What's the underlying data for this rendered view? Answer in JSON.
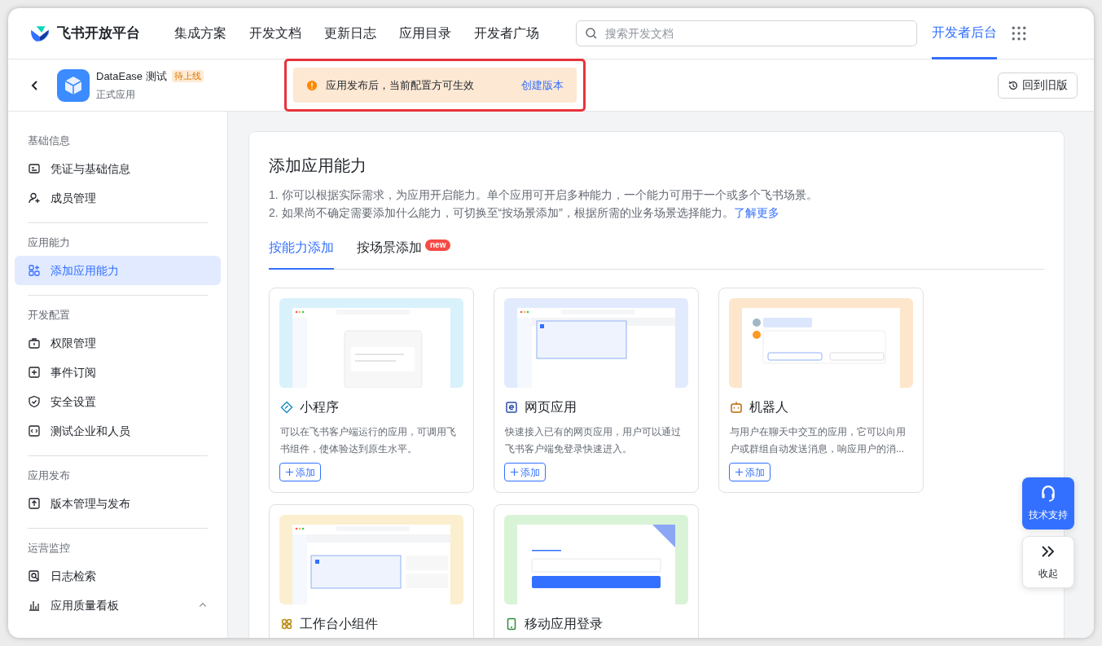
{
  "nav": {
    "brand": "飞书开放平台",
    "links": [
      {
        "label": "集成方案",
        "selected": false
      },
      {
        "label": "开发文档",
        "selected": false
      },
      {
        "label": "更新日志",
        "selected": false
      },
      {
        "label": "应用目录",
        "selected": false
      },
      {
        "label": "开发者广场",
        "selected": false
      }
    ],
    "search": {
      "placeholder": "搜索开发文档"
    },
    "console": {
      "label": "开发者后台",
      "selected": true
    }
  },
  "app": {
    "name": "DataEase 测试",
    "badge": "待上线",
    "type": "正式应用"
  },
  "alert": {
    "message": "应用发布后，当前配置方可生效",
    "link": "创建版本",
    "highlighted": true
  },
  "old_version_button": "回到旧版",
  "sidebar": [
    {
      "title": "基础信息",
      "items": [
        {
          "label": "凭证与基础信息",
          "selected": false
        },
        {
          "label": "成员管理",
          "selected": false
        }
      ]
    },
    {
      "title": "应用能力",
      "items": [
        {
          "label": "添加应用能力",
          "selected": true
        }
      ]
    },
    {
      "title": "开发配置",
      "items": [
        {
          "label": "权限管理",
          "selected": false
        },
        {
          "label": "事件订阅",
          "selected": false
        },
        {
          "label": "安全设置",
          "selected": false
        },
        {
          "label": "测试企业和人员",
          "selected": false
        }
      ]
    },
    {
      "title": "应用发布",
      "items": [
        {
          "label": "版本管理与发布",
          "selected": false
        }
      ]
    },
    {
      "title": "运营监控",
      "items": [
        {
          "label": "日志检索",
          "selected": false
        },
        {
          "label": "应用质量看板",
          "selected": false,
          "expanded": true
        }
      ]
    }
  ],
  "panel": {
    "title": "添加应用能力",
    "notes": [
      "1. 你可以根据实际需求，为应用开启能力。单个应用可开启多种能力，一个能力可用于一个或多个飞书场景。",
      "2. 如果尚不确定需要添加什么能力，可切换至“按场景添加”，根据所需的业务场景选择能力。"
    ],
    "learn_more": "了解更多",
    "tabs": [
      {
        "label": "按能力添加",
        "selected": true
      },
      {
        "label": "按场景添加",
        "selected": false,
        "badge": "new"
      }
    ],
    "cards": [
      {
        "kind": "mini_program",
        "title": "小程序",
        "description": "可以在飞书客户端运行的应用，可调用飞书组件，使体验达到原生水平。",
        "button": "添加"
      },
      {
        "kind": "web_app",
        "title": "网页应用",
        "description": "快速接入已有的网页应用，用户可以通过飞书客户端免登录快速进入。",
        "button": "添加"
      },
      {
        "kind": "bot",
        "title": "机器人",
        "description": "与用户在聊天中交互的应用，它可以向用户或群组自动发送消息，响应用户的消...",
        "button": "添加"
      },
      {
        "kind": "widget",
        "title": "工作台小组件"
      },
      {
        "kind": "mobile_login",
        "title": "移动应用登录"
      }
    ]
  },
  "float_buttons": [
    {
      "kind": "support",
      "label": "技术支持"
    },
    {
      "kind": "collapse",
      "label": "收起"
    }
  ]
}
